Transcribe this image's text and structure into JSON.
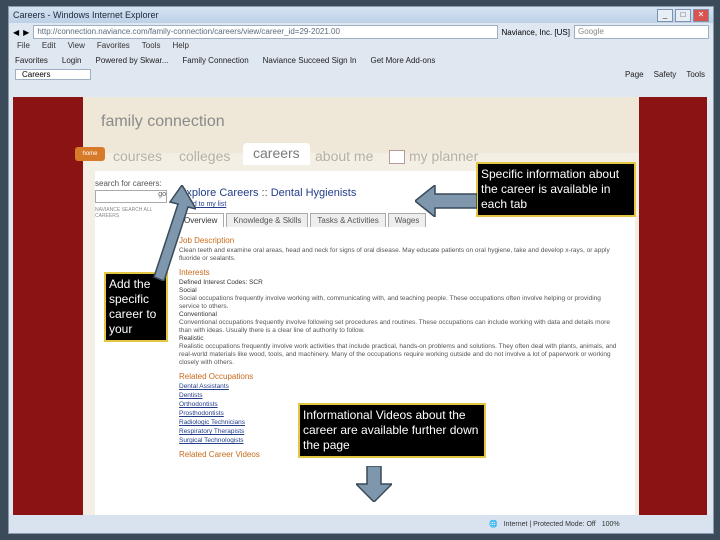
{
  "browser": {
    "title": "Careers - Windows Internet Explorer",
    "address": "http://connection.naviance.com/family-connection/careers/view/career_id=29-2021.00",
    "site_badge": "Naviance, Inc. [US]",
    "search_placeholder": "Google",
    "menu": [
      "File",
      "Edit",
      "View",
      "Favorites",
      "Tools",
      "Help"
    ],
    "favorites": [
      "Favorites",
      "Login",
      "Powered by Skwar...",
      "Family Connection",
      "Naviance Succeed Sign In",
      "Get More Add-ons"
    ],
    "tab": "Careers",
    "tabtools": [
      "Page",
      "Safety",
      "Tools"
    ],
    "status": "Internet | Protected Mode: Off",
    "zoom": "100%"
  },
  "page": {
    "brand": "family connection",
    "home": "home",
    "nav": [
      "courses",
      "colleges",
      "careers",
      "about me",
      "my planner"
    ],
    "search_label": "search for careers:",
    "search_button": "go",
    "search_note": "NAVIANCE SEARCH ALL CAREERS",
    "career_title": "Explore Careers",
    "career_sep": " :: ",
    "career_name": "Dental Hygienists",
    "add_link": "+ add to my list",
    "content_tabs": [
      "Overview",
      "Knowledge & Skills",
      "Tasks & Activities",
      "Wages"
    ],
    "sections": {
      "job": "Job Description",
      "job_text": "Clean teeth and examine oral areas, head and neck for signs of oral disease. May educate patients on oral hygiene, take and develop x-rays, or apply fluoride or sealants.",
      "interests": "Interests",
      "interest_items": [
        {
          "name": "Defined Interest Codes: SCR",
          "text": ""
        },
        {
          "name": "Social",
          "text": "Social occupations frequently involve working with, communicating with, and teaching people. These occupations often involve helping or providing service to others."
        },
        {
          "name": "Conventional",
          "text": "Conventional occupations frequently involve following set procedures and routines. These occupations can include working with data and details more than with ideas. Usually there is a clear line of authority to follow."
        },
        {
          "name": "Realistic",
          "text": "Realistic occupations frequently involve work activities that include practical, hands-on problems and solutions. They often deal with plants, animals, and real-world materials like wood, tools, and machinery. Many of the occupations require working outside and do not involve a lot of paperwork or working closely with others."
        }
      ],
      "related": "Related Occupations",
      "related_links": [
        "Dental Assistants",
        "Dentists",
        "Orthodontists",
        "Prosthodontists",
        "Radiologic Technicians",
        "Respiratory Therapists",
        "Surgical Technologists"
      ],
      "bottom": "Related Career Videos"
    }
  },
  "callouts": {
    "tab_info": "Specific information about the career is available in each tab",
    "add_career": "Add the specific career to your",
    "videos": "Informational Videos about the career are available further down the page"
  }
}
